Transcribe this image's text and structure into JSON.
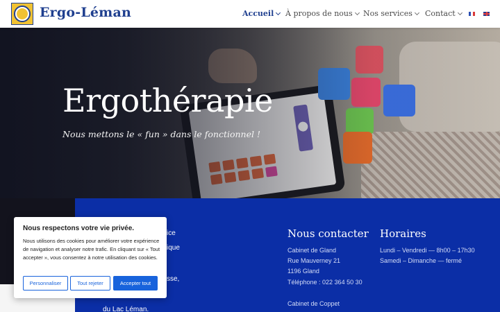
{
  "header": {
    "logo_text": "Ergo-Léman",
    "nav": [
      {
        "label": "Accueil",
        "active": true
      },
      {
        "label": "À propos de nous",
        "active": false
      },
      {
        "label": "Nos services",
        "active": false
      },
      {
        "label": "Contact",
        "active": false
      }
    ],
    "languages": [
      {
        "icon": "flag-fr-icon"
      },
      {
        "icon": "flag-en-icon"
      }
    ]
  },
  "hero": {
    "title": "Ergothérapie",
    "subtitle": "Nous mettons le « fun » dans le fonctionnel !"
  },
  "about_fragments": [
    "ice",
    "ique",
    "sse,",
    "du Lac Léman."
  ],
  "contact": {
    "title": "Nous contacter",
    "lines": [
      "Cabinet de Gland",
      "Rue Mauverney 21",
      "1196 Gland",
      "Téléphone : 022 364 50 30",
      "Cabinet de Coppet"
    ]
  },
  "hours": {
    "title": "Horaires",
    "lines": [
      "Lundi – Vendredi — 8h00 – 17h30",
      "Samedi – Dimanche — fermé"
    ]
  },
  "cookie": {
    "title": "Nous respectons votre vie privée.",
    "text": "Nous utilisons des cookies pour améliorer votre expérience de navigation et analyser notre trafic. En cliquant sur « Tout accepter », vous consentez à notre utilisation des cookies.",
    "customize_label": "Personnaliser",
    "reject_label": "Tout rejeter",
    "accept_label": "Accepter tout"
  },
  "colors": {
    "brand_blue": "#1f3f8f",
    "section_blue": "#0b2ea6",
    "cookie_accent": "#1863dc",
    "logo_yellow": "#f1c232"
  }
}
